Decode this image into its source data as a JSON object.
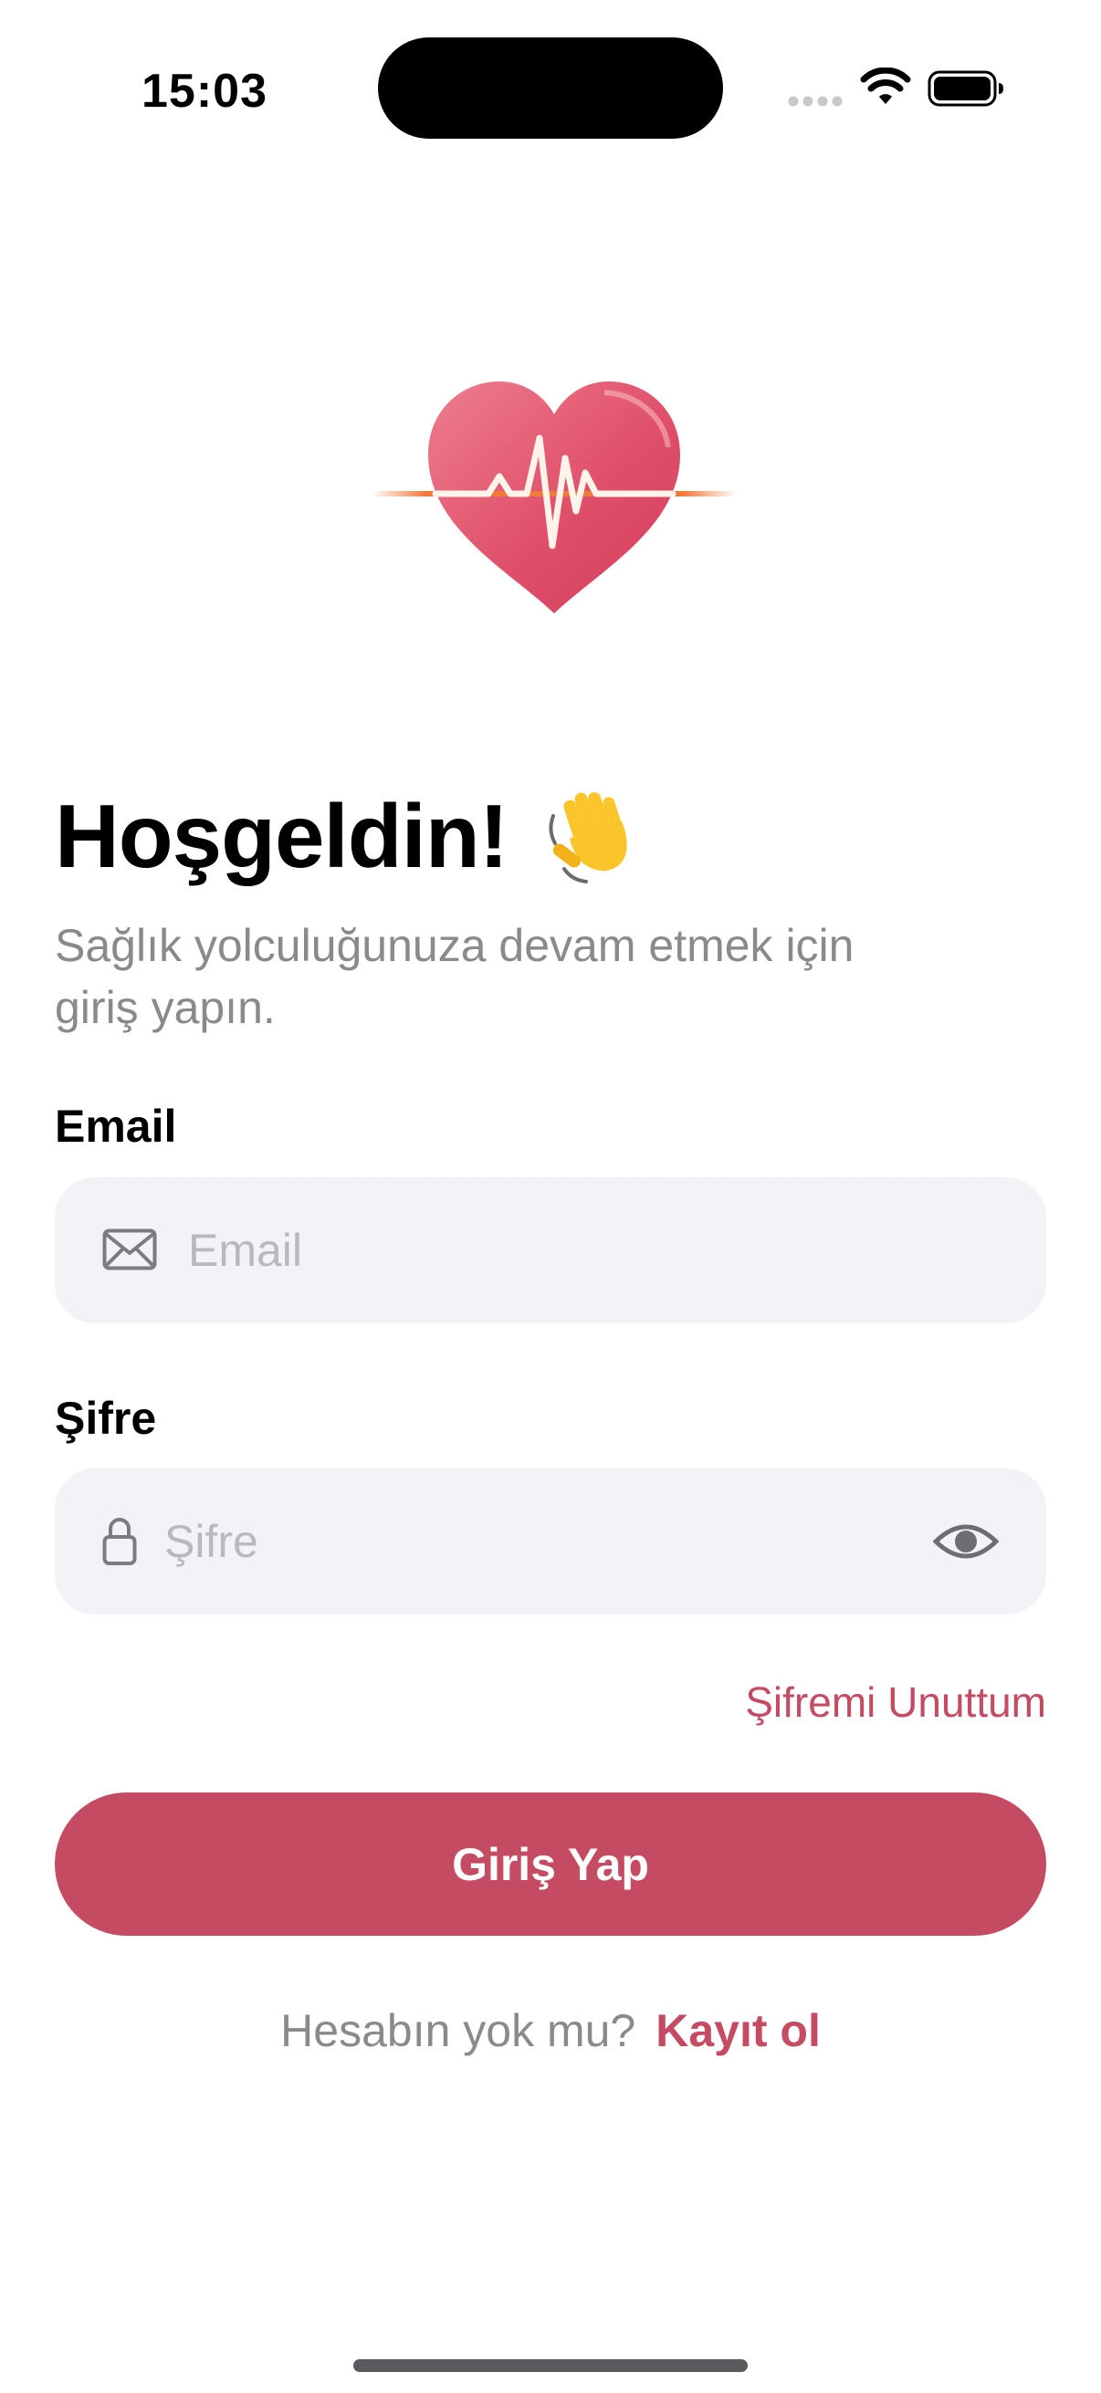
{
  "status_bar": {
    "time": "15:03",
    "icons": [
      "signal-dots-icon",
      "wifi-icon",
      "battery-icon"
    ]
  },
  "logo": {
    "icon": "heart-pulse-icon",
    "colors": {
      "heart": "#e0506a",
      "pulse": "#fff3ea",
      "line": "#f07a3a"
    }
  },
  "welcome": {
    "title": "Hoşgeldin!",
    "emoji_icon": "waving-hand-icon",
    "subtitle_line1": "Sağlık yolculuğunuza devam etmek için",
    "subtitle_line2": "giriş yapın."
  },
  "form": {
    "email_label": "Email",
    "email_placeholder": "Email",
    "email_icon": "envelope-icon",
    "password_label": "Şifre",
    "password_placeholder": "Şifre",
    "password_icon": "lock-icon",
    "password_toggle_icon": "eye-icon",
    "forgot_password": "Şifremi Unuttum",
    "submit_label": "Giriş Yap"
  },
  "signup": {
    "prompt": "Hesabın yok mu?",
    "link": "Kayıt ol"
  },
  "colors": {
    "accent": "#c44b62",
    "input_background": "#f2f2f7",
    "secondary_text": "#8a8a8e",
    "placeholder_text": "#b8b8bd"
  }
}
